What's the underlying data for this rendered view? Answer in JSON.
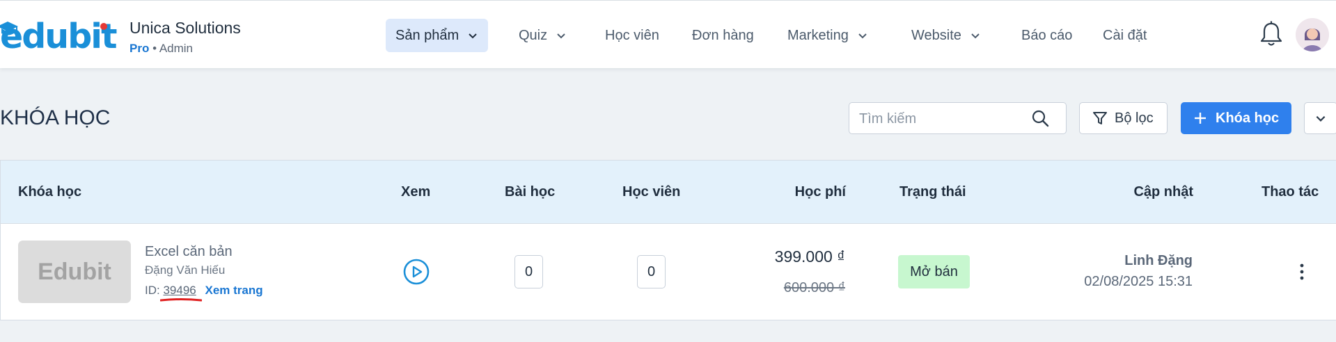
{
  "brand": {
    "logo_text": "edubit",
    "org_name": "Unica Solutions",
    "plan": "Pro",
    "separator": "•",
    "role": "Admin",
    "accent_color": "#1a8fd8"
  },
  "nav": {
    "items": [
      {
        "label": "Sản phẩm",
        "dropdown": true,
        "active": true
      },
      {
        "label": "Quiz",
        "dropdown": true
      },
      {
        "label": "Học viên",
        "dropdown": false
      },
      {
        "label": "Đơn hàng",
        "dropdown": false
      },
      {
        "label": "Marketing",
        "dropdown": true
      },
      {
        "label": "Website",
        "dropdown": true
      },
      {
        "label": "Báo cáo",
        "dropdown": false
      },
      {
        "label": "Cài đặt",
        "dropdown": false
      }
    ],
    "icons": [
      "bell-icon",
      "avatar"
    ]
  },
  "page": {
    "title": "KHÓA HỌC",
    "search_placeholder": "Tìm kiếm",
    "filter_label": "Bộ lọc",
    "add_label": "Khóa học",
    "primary_color": "#2f80ed"
  },
  "table": {
    "headers": {
      "course": "Khóa học",
      "view": "Xem",
      "lessons": "Bài học",
      "students": "Học viên",
      "fee": "Học phí",
      "status": "Trạng thái",
      "updated": "Cập nhật",
      "actions": "Thao tác"
    },
    "rows": [
      {
        "thumbnail_text": "Edubit",
        "name": "Excel căn bản",
        "author": "Đặng Văn Hiếu",
        "id_label": "ID:",
        "id": "39496",
        "view_page": "Xem trang",
        "lessons": "0",
        "students": "0",
        "price": "399.000 ₫",
        "old_price": "600.000 ₫",
        "status": "Mở bán",
        "updated_by": "Linh Đặng",
        "updated_at": "02/08/2025 15:31"
      }
    ]
  }
}
